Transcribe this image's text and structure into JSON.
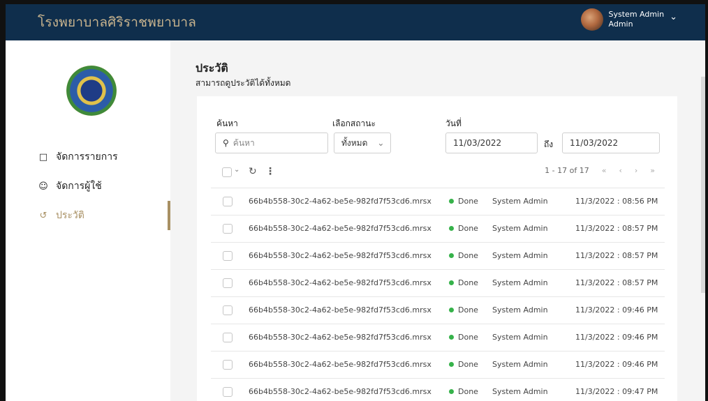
{
  "header": {
    "app_title": "โรงพยาบาลศิริราชพยาบาล",
    "user_name": "System Admin",
    "user_role": "Admin"
  },
  "sidebar": {
    "items": [
      {
        "label": "จัดการรายการ",
        "icon": "document-icon"
      },
      {
        "label": "จัดการผู้ใช้",
        "icon": "users-icon"
      },
      {
        "label": "ประวัติ",
        "icon": "history-icon"
      }
    ],
    "active_index": 2
  },
  "page": {
    "title": "ประวัติ",
    "subtitle": "สามารถดูประวัติได้ทั้งหมด"
  },
  "filters": {
    "search_label": "ค้นหา",
    "search_placeholder": "ค้นหา",
    "status_label": "เลือกสถานะ",
    "status_value": "ทั้งหมด",
    "date_label": "วันที่",
    "date_from": "11/03/2022",
    "date_to_label": "ถึง",
    "date_to": "11/03/2022"
  },
  "pagination": {
    "range": "1 - 17 of 17"
  },
  "table": {
    "rows": [
      {
        "file": "66b4b558-30c2-4a62-be5e-982fd7f53cd6.mrsx",
        "status": "Done",
        "user": "System Admin",
        "date": "11/3/2022 : 08:56 PM"
      },
      {
        "file": "66b4b558-30c2-4a62-be5e-982fd7f53cd6.mrsx",
        "status": "Done",
        "user": "System Admin",
        "date": "11/3/2022 : 08:57 PM"
      },
      {
        "file": "66b4b558-30c2-4a62-be5e-982fd7f53cd6.mrsx",
        "status": "Done",
        "user": "System Admin",
        "date": "11/3/2022 : 08:57 PM"
      },
      {
        "file": "66b4b558-30c2-4a62-be5e-982fd7f53cd6.mrsx",
        "status": "Done",
        "user": "System Admin",
        "date": "11/3/2022 : 08:57 PM"
      },
      {
        "file": "66b4b558-30c2-4a62-be5e-982fd7f53cd6.mrsx",
        "status": "Done",
        "user": "System Admin",
        "date": "11/3/2022 : 09:46 PM"
      },
      {
        "file": "66b4b558-30c2-4a62-be5e-982fd7f53cd6.mrsx",
        "status": "Done",
        "user": "System Admin",
        "date": "11/3/2022 : 09:46 PM"
      },
      {
        "file": "66b4b558-30c2-4a62-be5e-982fd7f53cd6.mrsx",
        "status": "Done",
        "user": "System Admin",
        "date": "11/3/2022 : 09:46 PM"
      },
      {
        "file": "66b4b558-30c2-4a62-be5e-982fd7f53cd6.mrsx",
        "status": "Done",
        "user": "System Admin",
        "date": "11/3/2022 : 09:47 PM"
      }
    ]
  },
  "colors": {
    "header_bg": "#0f2e4c",
    "accent_gold": "#a89063",
    "status_done": "#36b24a"
  }
}
